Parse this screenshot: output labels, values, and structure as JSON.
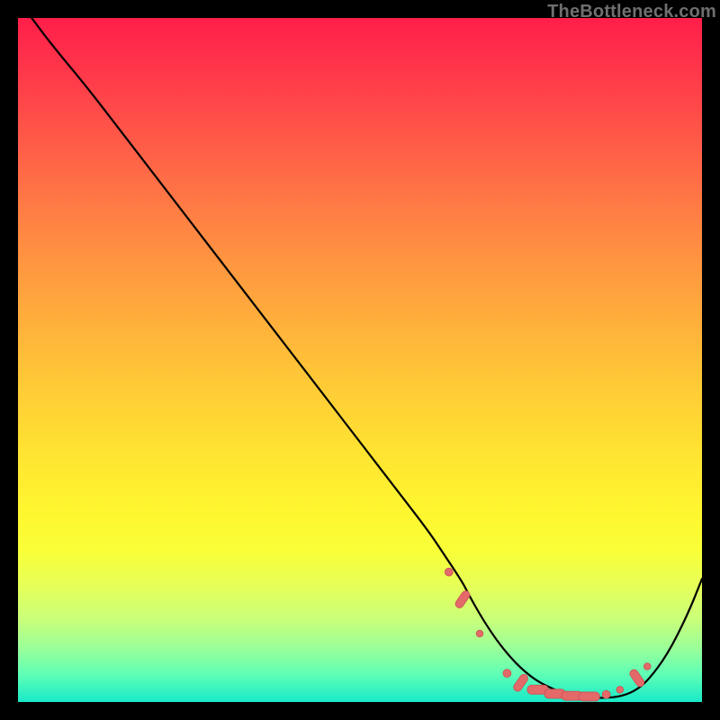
{
  "watermark": {
    "text": "TheBottleneck.com"
  },
  "colors": {
    "curve": "#000000",
    "dot_fill": "#e46a6a",
    "dot_stroke": "#cf5757",
    "background": "#000000"
  },
  "chart_data": {
    "type": "line",
    "title": "",
    "xlabel": "",
    "ylabel": "",
    "xlim": [
      0,
      100
    ],
    "ylim": [
      0,
      100
    ],
    "grid": false,
    "legend": false,
    "series": [
      {
        "name": "curve",
        "x": [
          2,
          5,
          10,
          15,
          20,
          25,
          30,
          35,
          40,
          45,
          50,
          55,
          60,
          62,
          65,
          66,
          68,
          70,
          72,
          74,
          76,
          78,
          80,
          82,
          84,
          86,
          88,
          90,
          92,
          95,
          98,
          100
        ],
        "y": [
          100,
          96,
          90,
          83.5,
          77,
          70.5,
          64,
          57.5,
          51,
          44.5,
          38,
          31.5,
          25,
          22,
          17.5,
          15.5,
          12,
          9,
          6.5,
          4.5,
          3,
          2,
          1.2,
          0.8,
          0.6,
          0.6,
          0.8,
          1.5,
          3,
          7,
          13,
          18
        ]
      }
    ],
    "markers": [
      {
        "x": 63.0,
        "y": 19.0,
        "shape": "dot",
        "size": 7
      },
      {
        "x": 65.0,
        "y": 15.0,
        "shape": "pill",
        "size": 8
      },
      {
        "x": 67.5,
        "y": 10.0,
        "shape": "dot",
        "size": 6
      },
      {
        "x": 71.5,
        "y": 4.2,
        "shape": "dot",
        "size": 7
      },
      {
        "x": 73.5,
        "y": 2.8,
        "shape": "pill",
        "size": 8
      },
      {
        "x": 76.0,
        "y": 1.8,
        "shape": "pill",
        "size": 9
      },
      {
        "x": 78.5,
        "y": 1.2,
        "shape": "pill",
        "size": 9
      },
      {
        "x": 81.0,
        "y": 0.9,
        "shape": "pill",
        "size": 9
      },
      {
        "x": 83.5,
        "y": 0.8,
        "shape": "pill",
        "size": 9
      },
      {
        "x": 86.0,
        "y": 1.1,
        "shape": "dot",
        "size": 7
      },
      {
        "x": 88.0,
        "y": 1.8,
        "shape": "dot",
        "size": 6
      },
      {
        "x": 90.5,
        "y": 3.5,
        "shape": "pill",
        "size": 8
      },
      {
        "x": 92.0,
        "y": 5.2,
        "shape": "dot",
        "size": 6
      }
    ]
  }
}
